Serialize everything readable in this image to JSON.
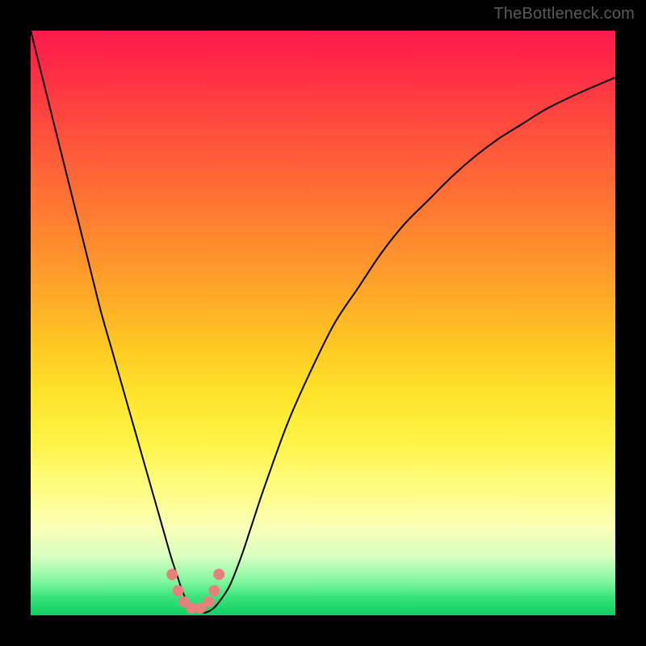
{
  "watermark": "TheBottleneck.com",
  "chart_data": {
    "type": "line",
    "title": "",
    "xlabel": "",
    "ylabel": "",
    "xlim": [
      0,
      100
    ],
    "ylim": [
      0,
      100
    ],
    "series": [
      {
        "name": "curve",
        "x": [
          0,
          2,
          4,
          6,
          8,
          10,
          12,
          14,
          16,
          18,
          20,
          22,
          24,
          25,
          26,
          27,
          28,
          29,
          30,
          31,
          32,
          34,
          36,
          38,
          40,
          44,
          48,
          52,
          56,
          60,
          64,
          68,
          72,
          76,
          80,
          84,
          88,
          92,
          96,
          100
        ],
        "values": [
          100,
          92,
          84,
          76,
          68,
          60,
          52,
          45,
          38,
          31,
          24,
          17,
          10,
          7,
          4,
          2,
          1,
          0.5,
          0.5,
          1,
          2,
          5,
          10,
          16,
          22,
          33,
          42,
          50,
          56,
          62,
          67,
          71,
          75,
          78.5,
          81.5,
          84,
          86.5,
          88.5,
          90.3,
          92
        ],
        "notch_x": [
          24.2,
          25.2,
          26.2,
          27.5,
          29.0,
          30.4,
          31.4,
          32.2
        ],
        "notch_y": [
          7.0,
          4.2,
          2.3,
          1.2,
          1.2,
          2.3,
          4.2,
          7.0
        ]
      }
    ]
  }
}
